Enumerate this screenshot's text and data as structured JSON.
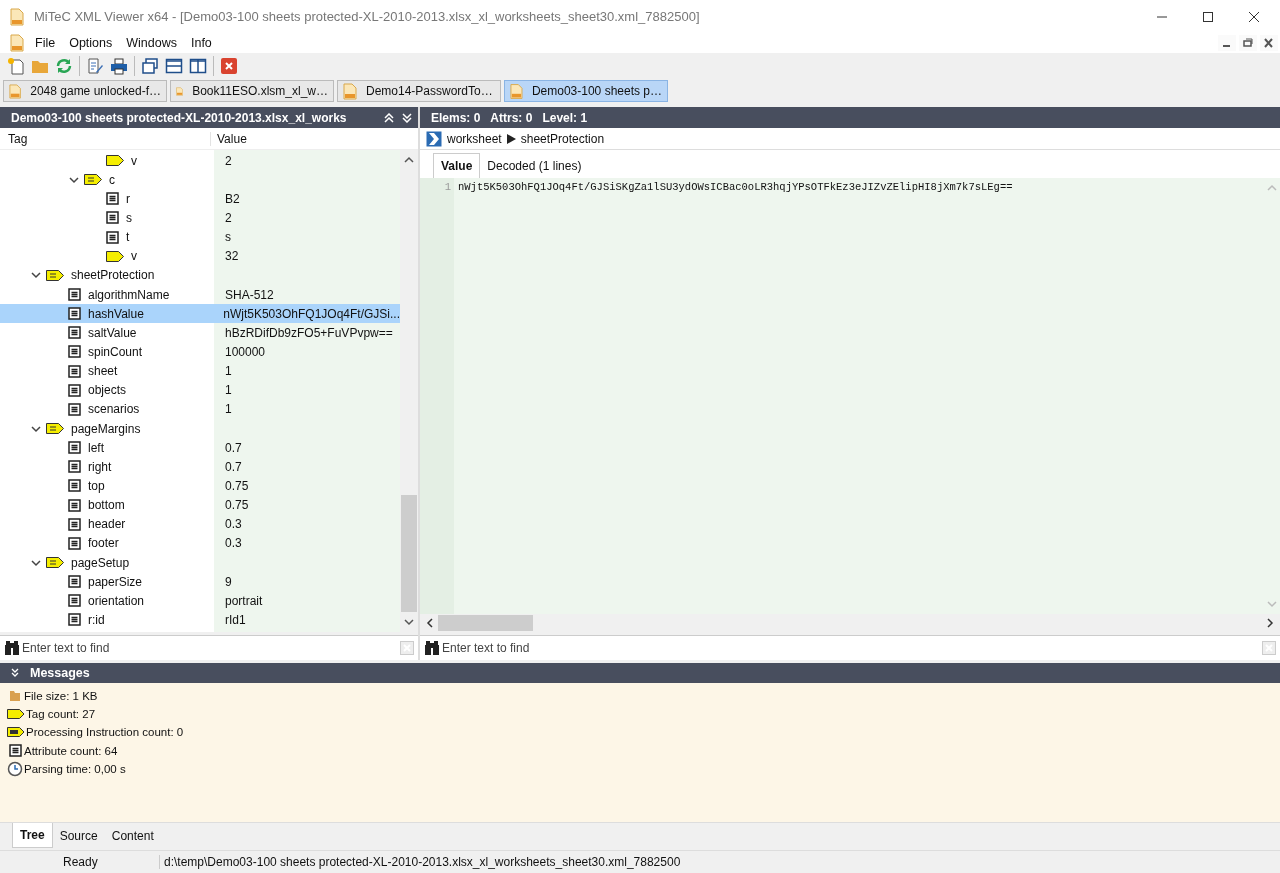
{
  "window": {
    "title": "MiTeC XML Viewer x64 - [Demo03-100 sheets protected-XL-2010-2013.xlsx_xl_worksheets_sheet30.xml_7882500]"
  },
  "menu": [
    "File",
    "Options",
    "Windows",
    "Info"
  ],
  "doc_tabs": [
    {
      "label": "2048 game unlocked-f…",
      "selected": false
    },
    {
      "label": "Book11ESO.xlsm_xl_w…",
      "selected": false
    },
    {
      "label": "Demo14-PasswordTo…",
      "selected": false
    },
    {
      "label": "Demo03-100 sheets p…",
      "selected": true
    }
  ],
  "tree_panel": {
    "title": "Demo03-100 sheets protected-XL-2010-2013.xlsx_xl_works",
    "columns": [
      "Tag",
      "Value"
    ],
    "tree": [
      {
        "children": [
          {
            "children": [
              {
                "kind": "text",
                "tag": "v",
                "value": "2",
                "selected": false
              }
            ]
          },
          {
            "kind": "element",
            "tag": "c",
            "expanded": true,
            "selected": false,
            "children": [
              {
                "kind": "attribute",
                "tag": "r",
                "value": "B2",
                "selected": false
              },
              {
                "kind": "attribute",
                "tag": "s",
                "value": "2",
                "selected": false
              },
              {
                "kind": "attribute",
                "tag": "t",
                "value": "s",
                "selected": false
              },
              {
                "kind": "text",
                "tag": "v",
                "value": "32",
                "selected": false
              }
            ]
          }
        ]
      },
      {
        "kind": "element",
        "tag": "sheetProtection",
        "expanded": true,
        "selected": false,
        "children": [
          {
            "kind": "attribute",
            "tag": "algorithmName",
            "value": "SHA-512",
            "selected": false
          },
          {
            "kind": "attribute",
            "tag": "hashValue",
            "value": "nWjt5K503OhFQ1JOq4Ft/GJSi...",
            "selected": true
          },
          {
            "kind": "attribute",
            "tag": "saltValue",
            "value": "hBzRDifDb9zFO5+FuVPvpw==",
            "selected": false
          },
          {
            "kind": "attribute",
            "tag": "spinCount",
            "value": "100000",
            "selected": false
          },
          {
            "kind": "attribute",
            "tag": "sheet",
            "value": "1",
            "selected": false
          },
          {
            "kind": "attribute",
            "tag": "objects",
            "value": "1",
            "selected": false
          },
          {
            "kind": "attribute",
            "tag": "scenarios",
            "value": "1",
            "selected": false
          }
        ]
      },
      {
        "kind": "element",
        "tag": "pageMargins",
        "expanded": true,
        "selected": false,
        "children": [
          {
            "kind": "attribute",
            "tag": "left",
            "value": "0.7",
            "selected": false
          },
          {
            "kind": "attribute",
            "tag": "right",
            "value": "0.7",
            "selected": false
          },
          {
            "kind": "attribute",
            "tag": "top",
            "value": "0.75",
            "selected": false
          },
          {
            "kind": "attribute",
            "tag": "bottom",
            "value": "0.75",
            "selected": false
          },
          {
            "kind": "attribute",
            "tag": "header",
            "value": "0.3",
            "selected": false
          },
          {
            "kind": "attribute",
            "tag": "footer",
            "value": "0.3",
            "selected": false
          }
        ]
      },
      {
        "kind": "element",
        "tag": "pageSetup",
        "expanded": true,
        "selected": false,
        "children": [
          {
            "kind": "attribute",
            "tag": "paperSize",
            "value": "9",
            "selected": false
          },
          {
            "kind": "attribute",
            "tag": "orientation",
            "value": "portrait",
            "selected": false
          },
          {
            "kind": "attribute",
            "tag": "r:id",
            "value": "rId1",
            "selected": false
          }
        ]
      }
    ],
    "find": {
      "placeholder": "Enter text to find"
    }
  },
  "detail_panel": {
    "stats": [
      "Elems: 0",
      "Attrs: 0",
      "Level: 1"
    ],
    "breadcrumb": [
      "worksheet",
      "sheetProtection"
    ],
    "tabs": [
      {
        "label": "Value",
        "selected": true
      },
      {
        "label": "Decoded (1 lines)",
        "selected": false
      }
    ],
    "lines": [
      {
        "number": "1",
        "text": "nWjt5K503OhFQ1JOq4Ft/GJSiSKgZa1lSU3ydOWsICBac0oLR3hqjYPsOTFkEz3eJIZvZElipHI8jXm7k7sLEg=="
      }
    ],
    "find": {
      "placeholder": "Enter text to find"
    }
  },
  "messages": {
    "title": "Messages",
    "items": [
      {
        "kind": "folder",
        "text": "File size: 1 KB"
      },
      {
        "kind": "tag",
        "text": "Tag count: 27"
      },
      {
        "kind": "pi",
        "text": "Processing Instruction count: 0"
      },
      {
        "kind": "attribute",
        "text": "Attribute count: 64"
      },
      {
        "kind": "clock",
        "text": "Parsing time: 0,00 s"
      }
    ]
  },
  "view_tabs": [
    {
      "label": "Tree",
      "selected": true
    },
    {
      "label": "Source",
      "selected": false
    },
    {
      "label": "Content",
      "selected": false
    }
  ],
  "status_bar": {
    "state": "Ready",
    "path": "d:\\temp\\Demo03-100 sheets protected-XL-2010-2013.xlsx_xl_worksheets_sheet30.xml_7882500"
  }
}
